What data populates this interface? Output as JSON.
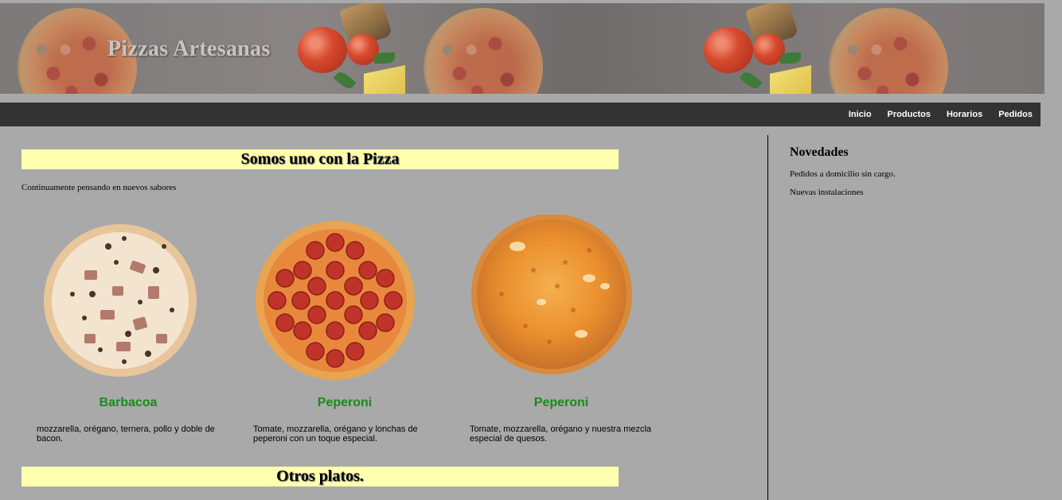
{
  "header": {
    "brand_title": "Pizzas Artesanas"
  },
  "nav": {
    "items": [
      {
        "label": "Inicio"
      },
      {
        "label": "Productos"
      },
      {
        "label": "Horarios"
      },
      {
        "label": "Pedidos"
      }
    ]
  },
  "main": {
    "heading": "Somos uno con la Pizza",
    "intro": "Continuamente pensando en nuevos sabores",
    "pizzas": [
      {
        "name": "Barbacoa",
        "description": "mozzarella, orégano, ternera, pollo y doble de bacon.",
        "image_icon": "bbq-pizza-image"
      },
      {
        "name": "Peperoni",
        "description": "Tomate, mozzarella, orégano y lonchas de peperoni con un toque especial.",
        "image_icon": "pepperoni-pizza-image"
      },
      {
        "name": "Peperoni",
        "description": "Tomate, mozzarella, orégano y nuestra mezcla especial de quesos.",
        "image_icon": "cheese-pizza-image"
      }
    ],
    "second_heading": "Otros platos."
  },
  "sidebar": {
    "title": "Novedades",
    "items": [
      {
        "text": "Pedidos a domicilio sin cargo."
      },
      {
        "text": "Nuevas instalaciones"
      }
    ]
  },
  "colors": {
    "page_background": "#a9a9a9",
    "nav_background": "#333333",
    "heading_background": "#ffffb0",
    "pizza_name": "#1a8a1a"
  }
}
